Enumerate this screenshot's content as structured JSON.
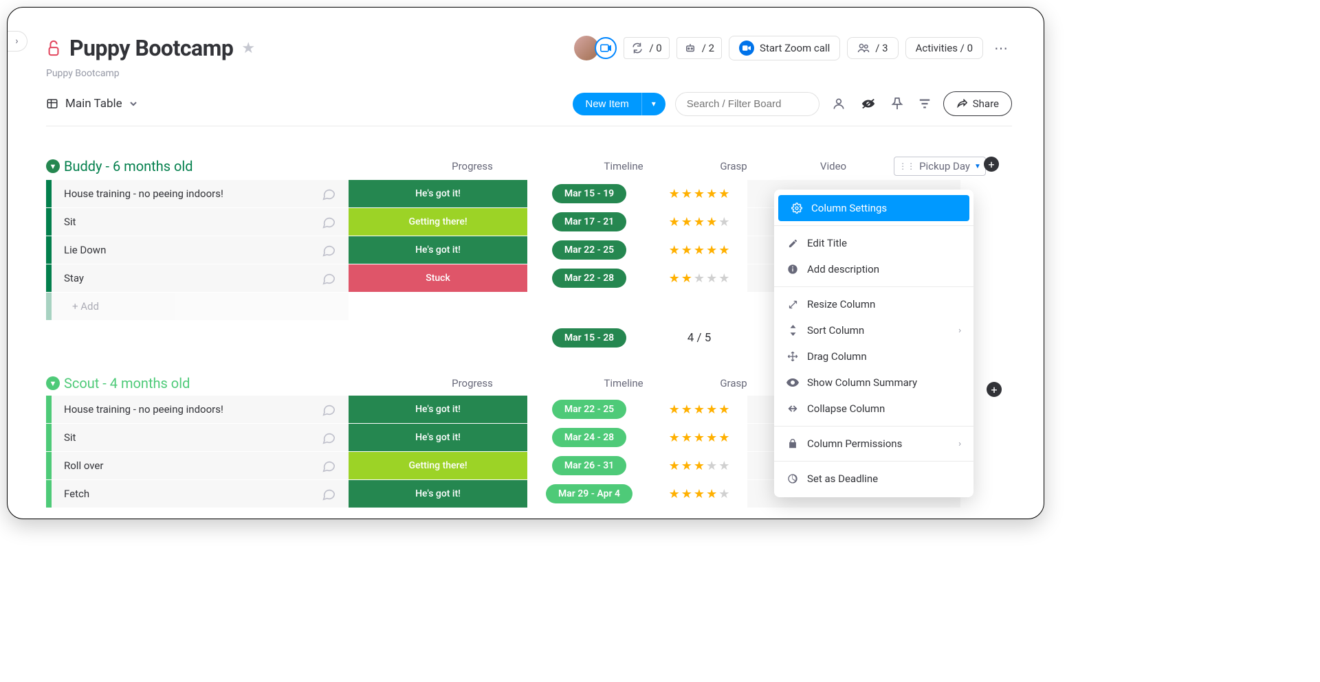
{
  "header": {
    "title": "Puppy Bootcamp",
    "breadcrumb": "Puppy Bootcamp",
    "counters": {
      "c1": "/ 0",
      "c2": "/ 2"
    },
    "zoom_label": "Start Zoom call",
    "people_label": "/ 3",
    "activities_label": "Activities / 0"
  },
  "toolbar": {
    "view": "Main Table",
    "new_item": "New Item",
    "search_placeholder": "Search / Filter Board",
    "share_label": "Share"
  },
  "columns": [
    "Progress",
    "Timeline",
    "Grasp",
    "Video",
    "Pickup Day"
  ],
  "add_row_label": "+ Add",
  "groups": [
    {
      "title": "Buddy - 6 months old",
      "color": "#037f4c",
      "toggle_color": "#258750",
      "timeline_chip_color": "#258750",
      "rows": [
        {
          "name": "House training - no peeing indoors!",
          "progress": {
            "label": "He's got it!",
            "cls": "pg-gotit"
          },
          "timeline": "Mar 15 - 19",
          "grasp": 5
        },
        {
          "name": "Sit",
          "progress": {
            "label": "Getting there!",
            "cls": "pg-getting"
          },
          "timeline": "Mar 17 - 21",
          "grasp": 4
        },
        {
          "name": "Lie Down",
          "progress": {
            "label": "He's got it!",
            "cls": "pg-gotit"
          },
          "timeline": "Mar 22 - 25",
          "grasp": 5
        },
        {
          "name": "Stay",
          "progress": {
            "label": "Stuck",
            "cls": "pg-stuck"
          },
          "timeline": "Mar 22 - 28",
          "grasp": 2
        }
      ],
      "summary": {
        "timeline": "Mar 15 - 28",
        "grasp": "4  / 5"
      }
    },
    {
      "title": "Scout - 4 months old",
      "color": "#4eca78",
      "toggle_color": "#4eca78",
      "timeline_chip_color": "#4eca78",
      "rows": [
        {
          "name": "House training - no peeing indoors!",
          "progress": {
            "label": "He's got it!",
            "cls": "pg-gotit"
          },
          "timeline": "Mar 22 - 25",
          "grasp": 5
        },
        {
          "name": "Sit",
          "progress": {
            "label": "He's got it!",
            "cls": "pg-gotit"
          },
          "timeline": "Mar 24 - 28",
          "grasp": 5
        },
        {
          "name": "Roll over",
          "progress": {
            "label": "Getting there!",
            "cls": "pg-getting"
          },
          "timeline": "Mar 26 - 31",
          "grasp": 3
        },
        {
          "name": "Fetch",
          "progress": {
            "label": "He's got it!",
            "cls": "pg-gotit"
          },
          "timeline": "Mar 29 - Apr 4",
          "grasp": 4
        }
      ]
    }
  ],
  "context_menu": {
    "items": [
      {
        "icon": "gear",
        "label": "Column Settings",
        "highlight": true
      },
      {
        "sep": true
      },
      {
        "icon": "pencil",
        "label": "Edit Title"
      },
      {
        "icon": "info",
        "label": "Add description"
      },
      {
        "sep": true
      },
      {
        "icon": "resize",
        "label": "Resize Column"
      },
      {
        "icon": "sort",
        "label": "Sort Column",
        "chev": true
      },
      {
        "icon": "drag",
        "label": "Drag Column"
      },
      {
        "icon": "eye",
        "label": "Show Column Summary"
      },
      {
        "icon": "collapse",
        "label": "Collapse Column"
      },
      {
        "sep": true
      },
      {
        "icon": "lock",
        "label": "Column Permissions",
        "chev": true
      },
      {
        "sep": true
      },
      {
        "icon": "clock",
        "label": "Set as Deadline"
      }
    ]
  }
}
